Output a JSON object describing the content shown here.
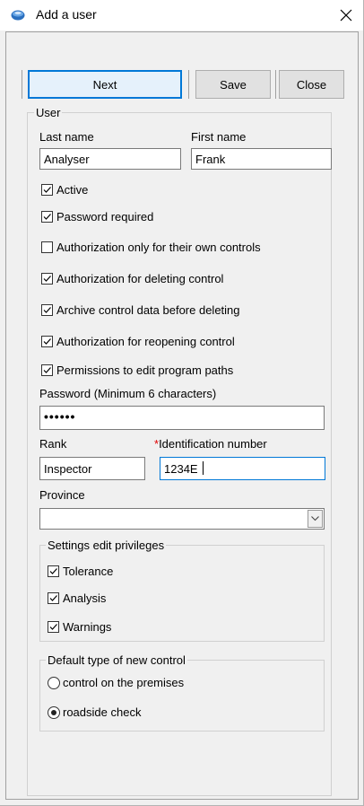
{
  "window": {
    "title": "Add a user",
    "title_icon": "app-globe-icon",
    "close_icon": "close-icon"
  },
  "toolbar": {
    "next_label": "Next",
    "save_label": "Save",
    "close_label": "Close"
  },
  "user_section": {
    "title": "User",
    "last_name_label": "Last name",
    "last_name_value": "Analyser",
    "first_name_label": "First name",
    "first_name_value": "Frank",
    "checkboxes": [
      {
        "label": "Active",
        "checked": true
      },
      {
        "label": "Password required",
        "checked": true
      },
      {
        "label": "Authorization only for their own controls",
        "checked": false
      },
      {
        "label": "Authorization for deleting control",
        "checked": true
      },
      {
        "label": "Archive control data before deleting",
        "checked": true
      },
      {
        "label": "Authorization for reopening control",
        "checked": true
      },
      {
        "label": "Permissions to edit program paths",
        "checked": true
      }
    ],
    "password_label": "Password (Minimum 6 characters)",
    "password_value": "••••••",
    "rank_label": "Rank",
    "rank_value": "Inspector",
    "id_required_marker": "*",
    "id_label": "Identification number",
    "id_value": "1234E",
    "province_label": "Province",
    "province_value": ""
  },
  "settings_privileges": {
    "title": "Settings edit privileges",
    "items": [
      {
        "label": "Tolerance",
        "checked": true
      },
      {
        "label": "Analysis",
        "checked": true
      },
      {
        "label": "Warnings",
        "checked": true
      }
    ]
  },
  "default_control": {
    "title": "Default type of new control",
    "options": [
      {
        "label": "control on the premises",
        "selected": false
      },
      {
        "label": "roadside check",
        "selected": true
      }
    ]
  },
  "colors": {
    "focus_border": "#0078d7",
    "required_marker": "#e00000"
  }
}
